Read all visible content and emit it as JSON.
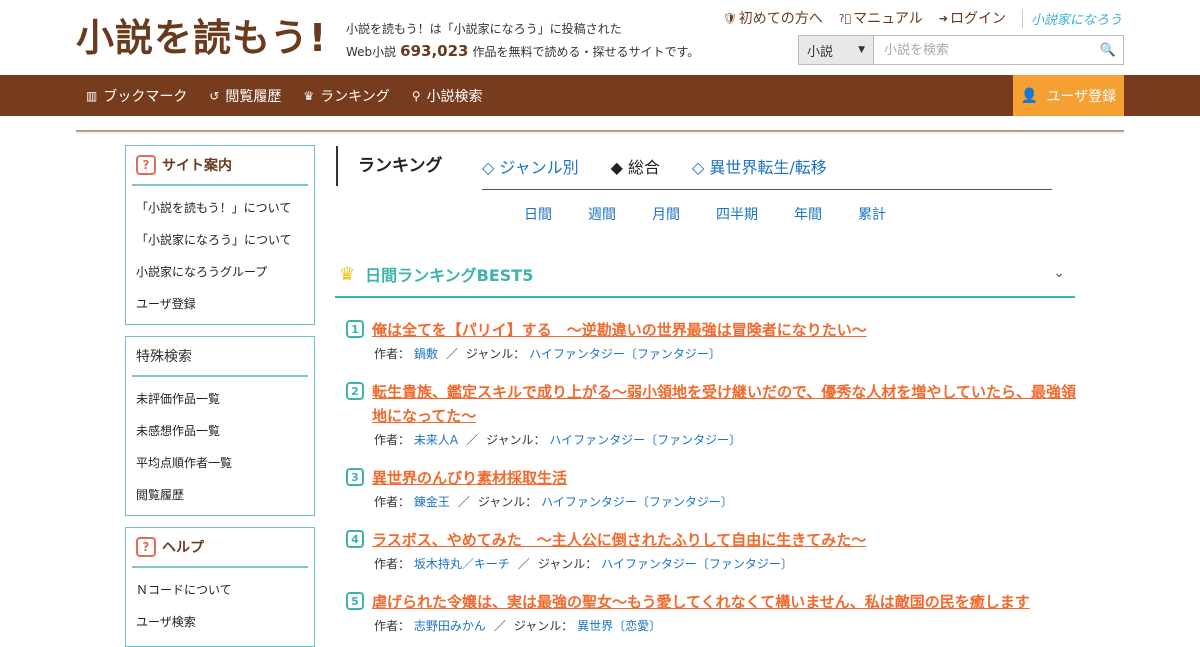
{
  "header": {
    "logo": "小説を読もう!",
    "tagline_line1": "小説を読もう！は「小説家になろう」に投稿された",
    "tagline_prefix": "Web小説",
    "work_count": "693,023",
    "tagline_suffix": "作品を無料で読める・探せるサイトです。",
    "links": [
      {
        "icon": "shield-icon",
        "label": "初めての方へ"
      },
      {
        "icon": "question-icon",
        "label": "マニュアル"
      },
      {
        "icon": "login-icon",
        "label": "ログイン"
      }
    ],
    "brand_link": "小説家になろう",
    "search": {
      "type_selected": "小説",
      "placeholder": "小説を検索"
    }
  },
  "nav": {
    "items": [
      {
        "label": "ブックマーク"
      },
      {
        "label": "閲覧履歴"
      },
      {
        "label": "ランキング"
      },
      {
        "label": "小説検索"
      }
    ],
    "register": "ユーザ登録"
  },
  "sidebar": {
    "site_guide": {
      "title": "サイト案内",
      "items": [
        "「小説を読もう！」について",
        "「小説家になろう」について",
        "小説家になろうグループ",
        "ユーザ登録"
      ]
    },
    "special_search": {
      "title": "特殊検索",
      "items": [
        "未評価作品一覧",
        "未感想作品一覧",
        "平均点順作者一覧",
        "閲覧履歴"
      ]
    },
    "help": {
      "title": "ヘルプ",
      "items": [
        "Ｎコードについて",
        "ユーザ検索"
      ]
    }
  },
  "ranking": {
    "title": "ランキング",
    "tabs": [
      "◇ ジャンル別",
      "◆ 総合",
      "◇ 異世界転生/転移"
    ],
    "periods": [
      "日間",
      "週間",
      "月間",
      "四半期",
      "年間",
      "累計"
    ],
    "best_title": "日間ランキングBEST5",
    "author_label": "作者：",
    "genre_label": "ジャンル：",
    "entries": [
      {
        "rank": "1",
        "title": "俺は全てを【パリイ】する　〜逆勘違いの世界最強は冒険者になりたい〜",
        "author": "鍋敷",
        "genre": "ハイファンタジー〔ファンタジー〕"
      },
      {
        "rank": "2",
        "title": "転生貴族、鑑定スキルで成り上がる～弱小領地を受け継いだので、優秀な人材を増やしていたら、最強領地になってた～",
        "author": "未来人A",
        "genre": "ハイファンタジー〔ファンタジー〕"
      },
      {
        "rank": "3",
        "title": "異世界のんびり素材採取生活",
        "author": "錬金王",
        "genre": "ハイファンタジー〔ファンタジー〕"
      },
      {
        "rank": "4",
        "title": "ラスボス、やめてみた　～主人公に倒されたふりして自由に生きてみた～",
        "author": "坂木持丸／キーチ",
        "genre": "ハイファンタジー〔ファンタジー〕"
      },
      {
        "rank": "5",
        "title": "虐げられた令嬢は、実は最強の聖女～もう愛してくれなくて構いません、私は敵国の民を癒します",
        "author": "志野田みかん",
        "genre": "異世界〔恋愛〕"
      }
    ]
  }
}
